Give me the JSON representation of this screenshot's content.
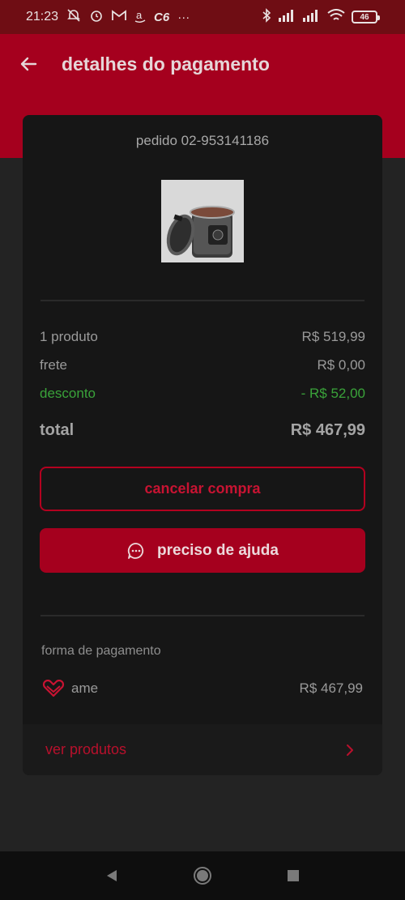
{
  "status_bar": {
    "time": "21:23",
    "left_icons": [
      "mute-alarm-icon",
      "alarm-icon",
      "gmail-icon",
      "amazon-icon",
      "c6-icon",
      "more-icon"
    ],
    "right_icons": [
      "bluetooth-icon",
      "signal-icon",
      "signal-icon",
      "wifi-icon"
    ],
    "c6_label": "C6",
    "more_label": "···",
    "battery": "46"
  },
  "header": {
    "title": "detalhes do pagamento"
  },
  "order": {
    "number": "pedido 02-953141186"
  },
  "summary": {
    "products_label": "1 produto",
    "products_value": "R$ 519,99",
    "shipping_label": "frete",
    "shipping_value": "R$ 0,00",
    "discount_label": "desconto",
    "discount_value": "- R$ 52,00",
    "total_label": "total",
    "total_value": "R$ 467,99"
  },
  "actions": {
    "cancel_label": "cancelar compra",
    "help_label": "preciso de ajuda"
  },
  "payment": {
    "section_label": "forma de pagamento",
    "method": "ame",
    "amount": "R$ 467,99"
  },
  "footer_link": {
    "label": "ver produtos"
  },
  "colors": {
    "brand": "#a5001e",
    "discount": "#3aa33a",
    "background": "#232323",
    "card": "#161616"
  }
}
